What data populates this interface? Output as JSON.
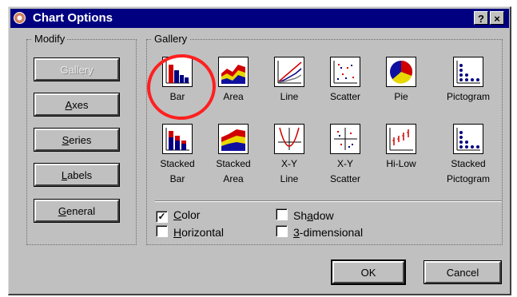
{
  "window": {
    "title": "Chart Options",
    "help_label": "?",
    "close_label": "×"
  },
  "modify": {
    "legend": "Modify",
    "buttons": [
      {
        "pre": "",
        "u": "",
        "post": "Gallery",
        "disabled": true
      },
      {
        "pre": "",
        "u": "A",
        "post": "xes",
        "disabled": false
      },
      {
        "pre": "",
        "u": "S",
        "post": "eries",
        "disabled": false
      },
      {
        "pre": "",
        "u": "L",
        "post": "abels",
        "disabled": false
      },
      {
        "pre": "",
        "u": "G",
        "post": "eneral",
        "disabled": false
      }
    ]
  },
  "gallery": {
    "legend": "Gallery",
    "items": [
      {
        "line1": "Bar",
        "line2": "",
        "icon": "bar-chart-icon"
      },
      {
        "line1": "Area",
        "line2": "",
        "icon": "area-chart-icon"
      },
      {
        "line1": "Line",
        "line2": "",
        "icon": "line-chart-icon"
      },
      {
        "line1": "Scatter",
        "line2": "",
        "icon": "scatter-chart-icon"
      },
      {
        "line1": "Pie",
        "line2": "",
        "icon": "pie-chart-icon"
      },
      {
        "line1": "Pictogram",
        "line2": "",
        "icon": "pictogram-chart-icon"
      },
      {
        "line1": "Stacked",
        "line2": "Bar",
        "icon": "stacked-bar-chart-icon"
      },
      {
        "line1": "Stacked",
        "line2": "Area",
        "icon": "stacked-area-chart-icon"
      },
      {
        "line1": "X-Y",
        "line2": "Line",
        "icon": "xy-line-chart-icon"
      },
      {
        "line1": "X-Y",
        "line2": "Scatter",
        "icon": "xy-scatter-chart-icon"
      },
      {
        "line1": "Hi-Low",
        "line2": "",
        "icon": "hi-low-chart-icon"
      },
      {
        "line1": "Stacked",
        "line2": "Pictogram",
        "icon": "stacked-pictogram-chart-icon"
      }
    ]
  },
  "options": {
    "color": {
      "u": "C",
      "post": "olor",
      "checked": true
    },
    "horizontal": {
      "u": "H",
      "post": "orizontal",
      "checked": false
    },
    "shadow": {
      "pre": "Sh",
      "u": "a",
      "post": "dow",
      "checked": false
    },
    "three_d": {
      "u": "3",
      "post": "-dimensional",
      "checked": false
    }
  },
  "footer": {
    "ok_label": "OK",
    "cancel_label": "Cancel"
  },
  "colors": {
    "titlebar": "#000080",
    "face": "#c0c0c0",
    "highlight_circle": "#ff2020"
  }
}
